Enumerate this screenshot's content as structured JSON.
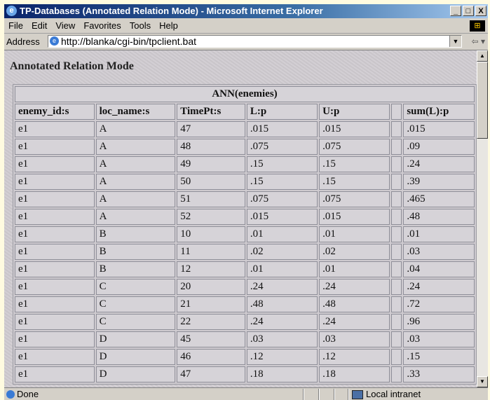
{
  "window": {
    "title": "TP-Databases (Annotated Relation Mode) - Microsoft Internet Explorer",
    "buttons": [
      "_",
      "□",
      "X"
    ]
  },
  "menu": [
    "File",
    "Edit",
    "View",
    "Favorites",
    "Tools",
    "Help"
  ],
  "address": {
    "label": "Address",
    "url": "http://blanka/cgi-bin/tpclient.bat"
  },
  "page": {
    "heading": "Annotated Relation Mode",
    "relation_name": "ANN(enemies)",
    "columns": [
      "enemy_id:s",
      "loc_name:s",
      "TimePt:s",
      "L:p",
      "U:p",
      "",
      "sum(L):p"
    ],
    "rows": [
      [
        "e1",
        "A",
        "47",
        ".015",
        ".015",
        "",
        ".015"
      ],
      [
        "e1",
        "A",
        "48",
        ".075",
        ".075",
        "",
        ".09"
      ],
      [
        "e1",
        "A",
        "49",
        ".15",
        ".15",
        "",
        ".24"
      ],
      [
        "e1",
        "A",
        "50",
        ".15",
        ".15",
        "",
        ".39"
      ],
      [
        "e1",
        "A",
        "51",
        ".075",
        ".075",
        "",
        ".465"
      ],
      [
        "e1",
        "A",
        "52",
        ".015",
        ".015",
        "",
        ".48"
      ],
      [
        "e1",
        "B",
        "10",
        ".01",
        ".01",
        "",
        ".01"
      ],
      [
        "e1",
        "B",
        "11",
        ".02",
        ".02",
        "",
        ".03"
      ],
      [
        "e1",
        "B",
        "12",
        ".01",
        ".01",
        "",
        ".04"
      ],
      [
        "e1",
        "C",
        "20",
        ".24",
        ".24",
        "",
        ".24"
      ],
      [
        "e1",
        "C",
        "21",
        ".48",
        ".48",
        "",
        ".72"
      ],
      [
        "e1",
        "C",
        "22",
        ".24",
        ".24",
        "",
        ".96"
      ],
      [
        "e1",
        "D",
        "45",
        ".03",
        ".03",
        "",
        ".03"
      ],
      [
        "e1",
        "D",
        "46",
        ".12",
        ".12",
        "",
        ".15"
      ],
      [
        "e1",
        "D",
        "47",
        ".18",
        ".18",
        "",
        ".33"
      ]
    ]
  },
  "status": {
    "text": "Done",
    "zone": "Local intranet"
  },
  "colors": {
    "titlebar": "#0a246a",
    "chrome": "#d4d0c8",
    "page_background": "#cfcbd0"
  }
}
